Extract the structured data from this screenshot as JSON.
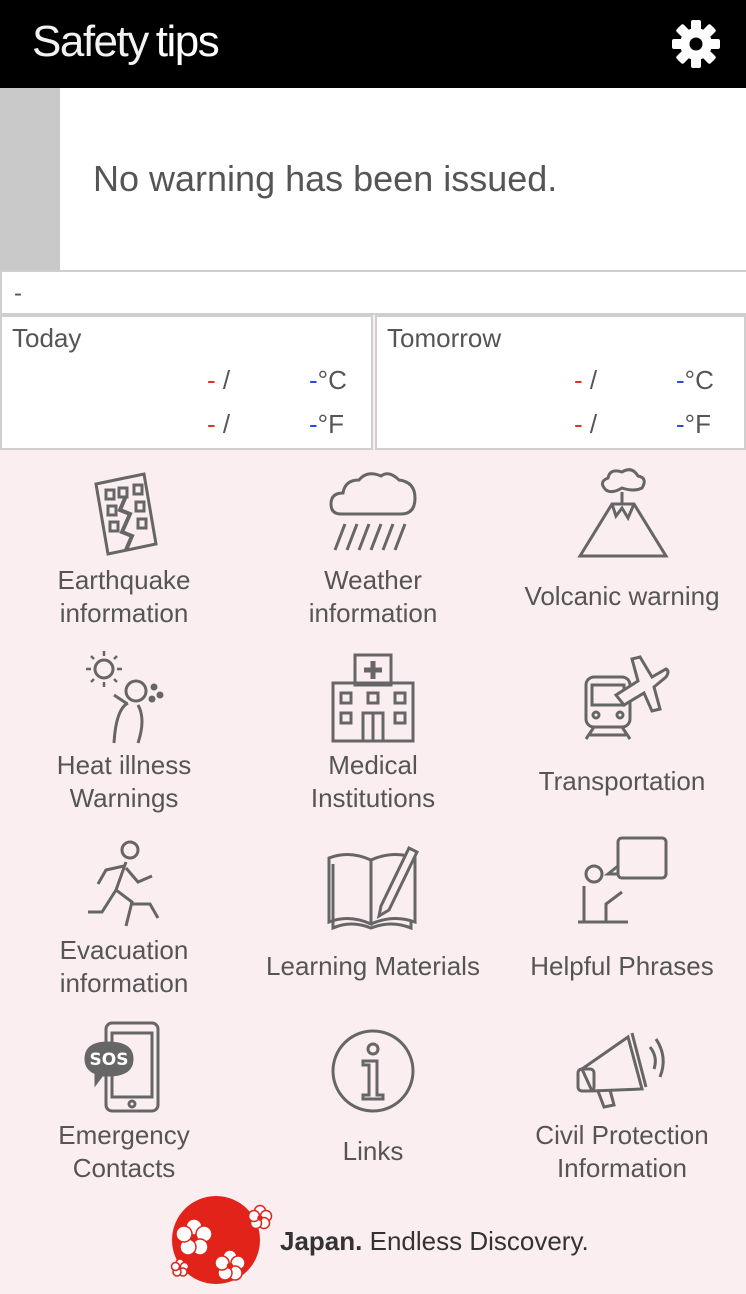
{
  "app": {
    "title_part1": "Safety",
    "title_part2": "tips"
  },
  "warning": {
    "message": "No warning has been issued."
  },
  "area": {
    "name": "-"
  },
  "forecast": {
    "today": {
      "label": "Today",
      "high_c": "-",
      "low_c": "-",
      "unit_c": "°C",
      "high_f": "-",
      "low_f": "-",
      "unit_f": "°F",
      "sep": "/"
    },
    "tomorrow": {
      "label": "Tomorrow",
      "high_c": "-",
      "low_c": "-",
      "unit_c": "°C",
      "high_f": "-",
      "low_f": "-",
      "unit_f": "°F",
      "sep": "/"
    }
  },
  "menu": [
    {
      "line1": "Earthquake",
      "line2": "information",
      "icon": "building-crack-icon"
    },
    {
      "line1": "Weather",
      "line2": "information",
      "icon": "rain-cloud-icon"
    },
    {
      "line1": "Volcanic warning",
      "line2": "",
      "icon": "volcano-icon"
    },
    {
      "line1": "Heat illness",
      "line2": "Warnings",
      "icon": "heat-person-icon"
    },
    {
      "line1": "Medical",
      "line2": "Institutions",
      "icon": "hospital-icon"
    },
    {
      "line1": "Transportation",
      "line2": "",
      "icon": "train-plane-icon"
    },
    {
      "line1": "Evacuation",
      "line2": "information",
      "icon": "running-person-icon"
    },
    {
      "line1": "Learning Materials",
      "line2": "",
      "icon": "book-pen-icon"
    },
    {
      "line1": "Helpful Phrases",
      "line2": "",
      "icon": "speech-person-icon"
    },
    {
      "line1": "Emergency",
      "line2": "Contacts",
      "icon": "sos-phone-icon"
    },
    {
      "line1": "Links",
      "line2": "",
      "icon": "info-icon"
    },
    {
      "line1": "Civil Protection",
      "line2": "Information",
      "icon": "megaphone-icon"
    }
  ],
  "footer": {
    "brand_bold": "Japan.",
    "brand_rest": " Endless Discovery."
  },
  "colors": {
    "header_bg": "#000000",
    "menu_bg": "#fbeef1",
    "temp_high": "#e0302a",
    "temp_low": "#2a4bd9",
    "logo_red": "#e2231a"
  }
}
